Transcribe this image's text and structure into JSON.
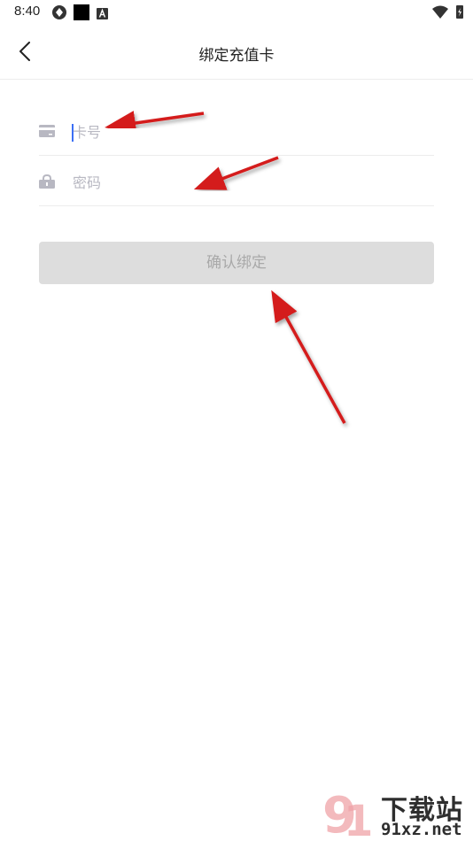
{
  "status_bar": {
    "time": "8:40",
    "icons_left": [
      "vpn-icon",
      "black-square-icon",
      "a-badge-icon"
    ],
    "icons_right": [
      "wifi-icon",
      "battery-charging-icon"
    ]
  },
  "header": {
    "title": "绑定充值卡",
    "back_icon": "chevron-left-icon"
  },
  "form": {
    "card_number": {
      "placeholder": "卡号",
      "value": "",
      "icon": "card-icon"
    },
    "password": {
      "placeholder": "密码",
      "value": "",
      "icon": "lock-icon"
    },
    "confirm_label": "确认绑定"
  },
  "watermark": {
    "text_top": "下载站",
    "text_bottom": "91xz.net"
  },
  "colors": {
    "accent": "#3b6ff5",
    "button_bg": "#dddddd",
    "button_text": "#a9a9a9",
    "placeholder": "#b8b8c2",
    "annotation_arrow": "#d41a1a"
  }
}
